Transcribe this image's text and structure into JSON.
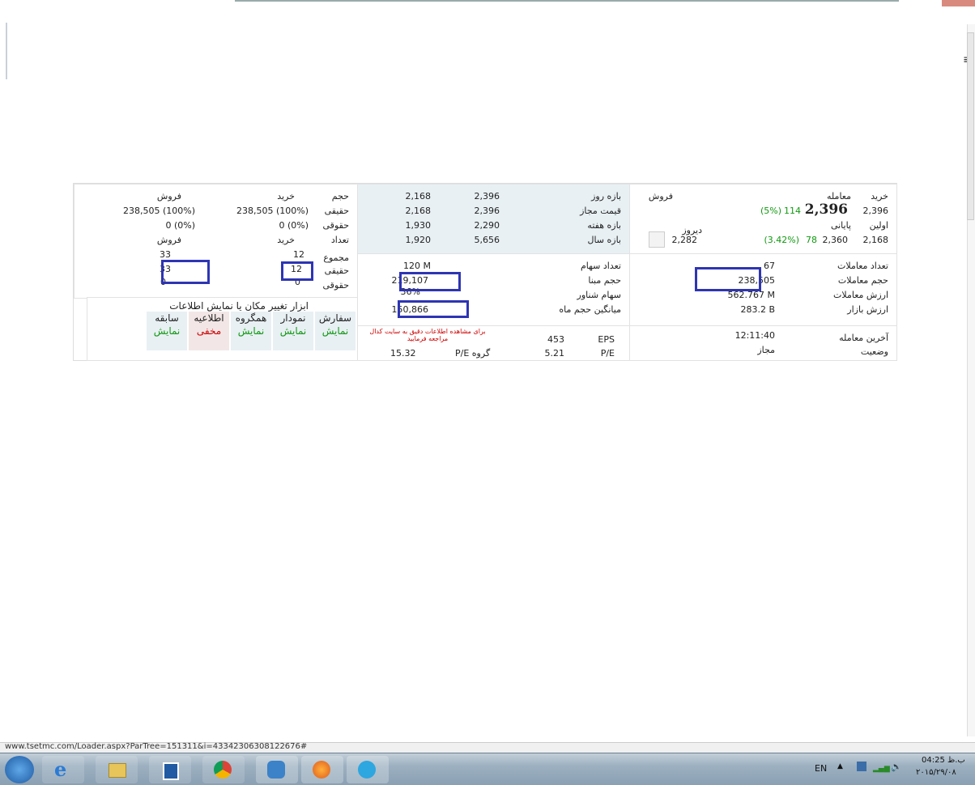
{
  "status_url": "www.tsetmc.com/Loader.aspx?ParTree=151311&i=43342306308122676#",
  "taskbar": {
    "lang": "EN",
    "time": "04:25 ب.ظ",
    "date": "۲۰۱۵/۲۹/۰۸"
  },
  "info_left": {
    "buy_label": "خرید",
    "trade_label": "معامله",
    "sell_label": "فروش",
    "price_buy": "2,396",
    "price_last": "2,396",
    "last_change": "114",
    "last_pct": "(5%)",
    "first_label": "اولین",
    "final_label": "پایانی",
    "first_val": "2,168",
    "final_val": "2,360",
    "final_change": "78",
    "final_pct": "(3.42%)",
    "yesterday_label": "دیروز",
    "yesterday_val": "2,282",
    "trades_count_label": "تعداد معاملات",
    "trades_count": "67",
    "trade_volume_label": "حجم معاملات",
    "trade_volume": "238,505",
    "trade_value_label": "ارزش معاملات",
    "trade_value": "562.767 M",
    "market_value_label": "ارزش بازار",
    "market_value": "283.2 B",
    "last_trade_label": "آخرین معامله",
    "last_trade_time": "12:11:40",
    "status_label": "وضعیت",
    "status_val": "مجاز"
  },
  "ranges": {
    "day_label": "بازه روز",
    "day_a": "2,396",
    "day_b": "2,168",
    "allowed_label": "قیمت مجاز",
    "allowed_a": "2,396",
    "allowed_b": "2,168",
    "week_label": "بازه هفته",
    "week_a": "2,290",
    "week_b": "1,930",
    "year_label": "بازه سال",
    "year_a": "5,656",
    "year_b": "1,920",
    "shares_label": "تعداد سهام",
    "shares": "120 M",
    "base_vol_label": "حجم مبنا",
    "base_vol": "219,107",
    "float_label": "سهام شناور",
    "float": "36%",
    "avg_month_label": "میانگین حجم ماه",
    "avg_month": "150,866",
    "eps_label": "EPS",
    "eps": "453",
    "pe_label": "P/E",
    "pe": "5.21",
    "group_pe_label": "P/E گروه",
    "group_pe": "15.32",
    "codal_note": "برای مشاهده اطلاعات دقیق به سایت کدال مراجعه فرمایید"
  },
  "people": {
    "vol_label": "حجم",
    "buy_label": "خرید",
    "sell_label": "فروش",
    "real_label": "حقیقی",
    "legal_label": "حقوقی",
    "real_buy": "238,505 (100%)",
    "real_sell": "238,505 (100%)",
    "legal_buy": "0 (0%)",
    "legal_sell": "0 (0%)",
    "count_label": "تعداد",
    "count_buy": "خرید",
    "count_sell": "فروش",
    "total_label": "مجموع",
    "total_buy": "12",
    "total_sell": "33",
    "real_buy_count": "12",
    "real_sell_count": "33",
    "legal_buy_count": "0",
    "legal_sell_count": "0",
    "tools_title": "ابزار تغییر مکان یا نمایش اطلاعات",
    "tools": [
      {
        "top": "سفارش",
        "bottom": "نمایش"
      },
      {
        "top": "نمودار",
        "bottom": "نمایش"
      },
      {
        "top": "همگروه",
        "bottom": "نمایش"
      },
      {
        "top": "اطلاعیه",
        "bottom": "مخفی"
      },
      {
        "top": "سابقه",
        "bottom": "نمایش"
      }
    ]
  }
}
